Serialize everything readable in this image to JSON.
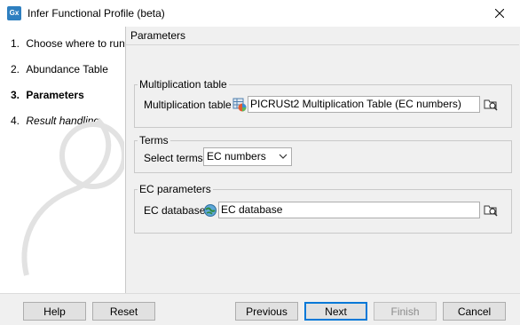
{
  "window": {
    "app_icon_text": "Gx",
    "title": "Infer Functional Profile (beta)"
  },
  "steps": [
    {
      "num": "1.",
      "label": "Choose where to run",
      "state": "normal"
    },
    {
      "num": "2.",
      "label": "Abundance Table",
      "state": "normal"
    },
    {
      "num": "3.",
      "label": "Parameters",
      "state": "active"
    },
    {
      "num": "4.",
      "label": "Result handling",
      "state": "italic"
    }
  ],
  "panel": {
    "title": "Parameters",
    "multiplication": {
      "legend": "Multiplication table",
      "label": "Multiplication table",
      "value": "PICRUSt2 Multiplication Table (EC numbers)"
    },
    "terms": {
      "legend": "Terms",
      "label": "Select terms",
      "selected": "EC numbers"
    },
    "ec": {
      "legend": "EC parameters",
      "label": "EC database",
      "value": "EC database"
    }
  },
  "buttons": {
    "help": "Help",
    "reset": "Reset",
    "previous": "Previous",
    "next": "Next",
    "finish": "Finish",
    "cancel": "Cancel"
  }
}
